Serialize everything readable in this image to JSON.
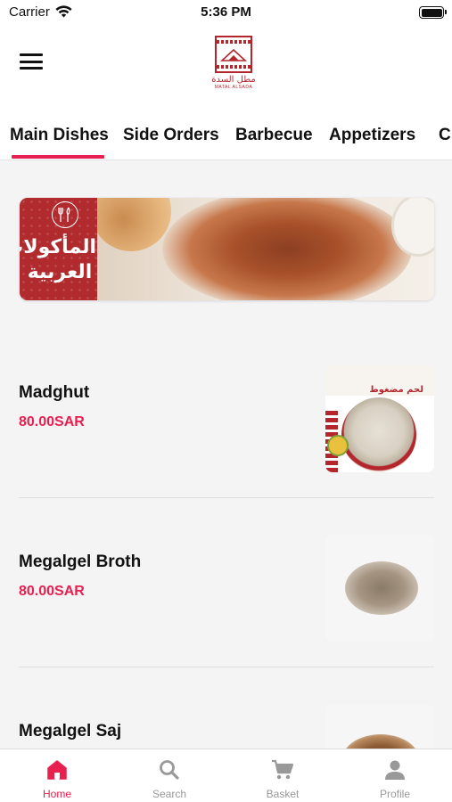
{
  "status_bar": {
    "carrier": "Carrier",
    "time": "5:36 PM"
  },
  "header": {
    "logo_arabic": "مطل السدة",
    "logo_english": "MATAL ALSADA"
  },
  "category_tabs": [
    {
      "label": "Main Dishes",
      "active": true
    },
    {
      "label": "Side Orders",
      "active": false
    },
    {
      "label": "Barbecue",
      "active": false
    },
    {
      "label": "Appetizers",
      "active": false
    },
    {
      "label": "Cl",
      "active": false
    }
  ],
  "banner": {
    "text": "المأكولات العربية"
  },
  "menu_items": [
    {
      "name": "Madghut",
      "price": "80.00SAR",
      "image_caption": "لحم مضغوط"
    },
    {
      "name": "Megalgel Broth",
      "price": "80.00SAR"
    },
    {
      "name": "Megalgel Saj",
      "price": ""
    }
  ],
  "tab_bar": [
    {
      "label": "Home",
      "icon": "home-icon",
      "active": true
    },
    {
      "label": "Search",
      "icon": "search-icon",
      "active": false
    },
    {
      "label": "Basket",
      "icon": "cart-icon",
      "active": false
    },
    {
      "label": "Profile",
      "icon": "person-icon",
      "active": false
    }
  ],
  "colors": {
    "accent": "#e8204f",
    "brand_red": "#b3262c",
    "background": "#f4f4f5"
  }
}
